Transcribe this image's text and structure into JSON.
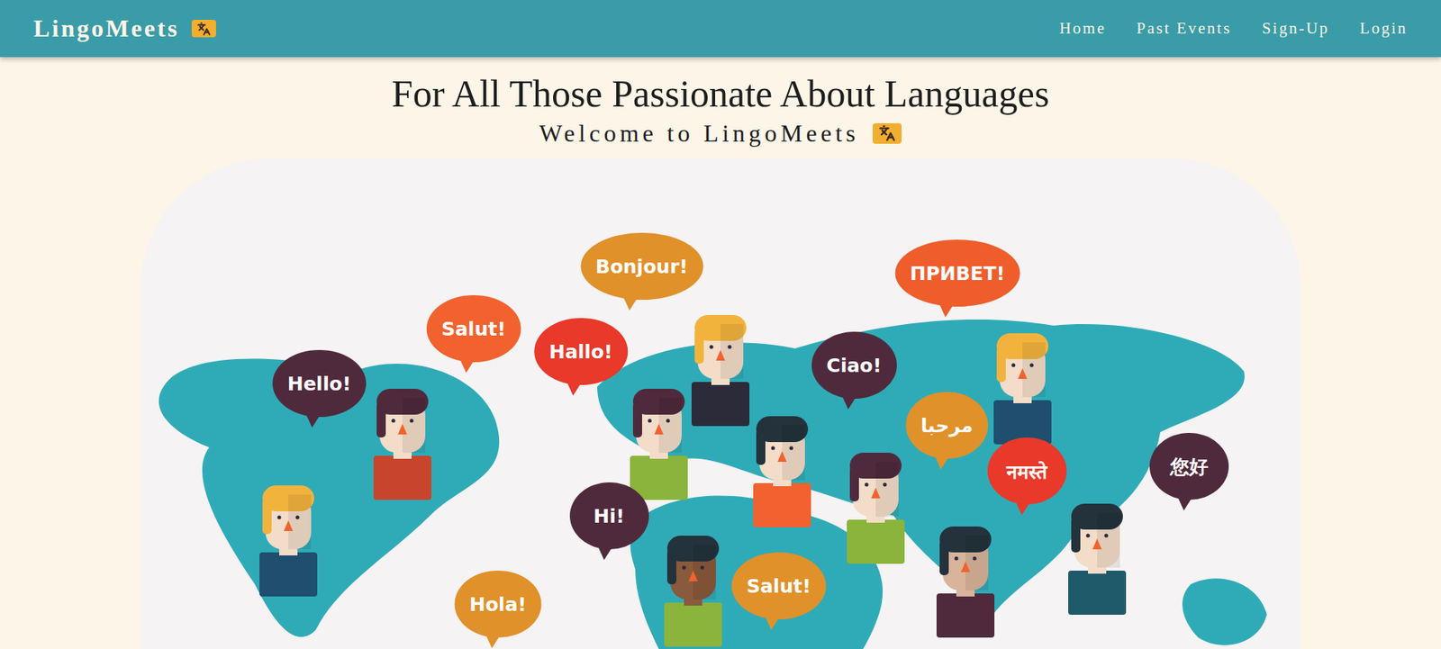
{
  "navbar": {
    "brand": "LingoMeets",
    "links": [
      {
        "label": "Home"
      },
      {
        "label": "Past Events"
      },
      {
        "label": "Sign-Up"
      },
      {
        "label": "Login"
      }
    ]
  },
  "hero": {
    "title": "For All Those Passionate About Languages",
    "subtitle": "Welcome to LingoMeets"
  },
  "illustration": {
    "bubbles": [
      {
        "text": "Hello!",
        "color": "#4f2a3c"
      },
      {
        "text": "Salut!",
        "color": "#f2622e"
      },
      {
        "text": "Bonjour!",
        "color": "#e0912a"
      },
      {
        "text": "Hallo!",
        "color": "#e8392a"
      },
      {
        "text": "Ciao!",
        "color": "#4f2a3c"
      },
      {
        "text": "ПРИВЕТ!",
        "color": "#ef5d2b"
      },
      {
        "text": "مرحبا",
        "color": "#e0912a"
      },
      {
        "text": "नमस्ते",
        "color": "#e8392a"
      },
      {
        "text": "您好",
        "color": "#4f2a3c"
      },
      {
        "text": "Hi!",
        "color": "#4f2a3c"
      },
      {
        "text": "Salut!",
        "color": "#e0912a"
      },
      {
        "text": "Hola!",
        "color": "#e0912a"
      }
    ]
  }
}
